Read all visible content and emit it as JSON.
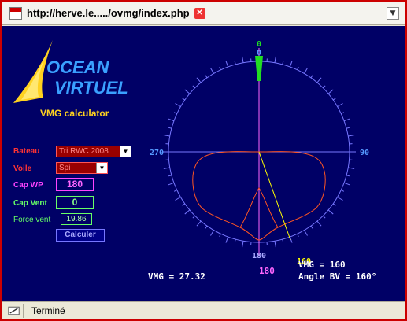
{
  "window": {
    "url": "http://herve.le...../ovmg/index.php"
  },
  "app": {
    "subtitle": "VMG calculator",
    "colors": {
      "background": "#000066",
      "accent": "#ffd21f",
      "polar": "#ff5522",
      "heading": "#ffff00",
      "compass": "#7777ff"
    }
  },
  "form": {
    "bateau": {
      "label": "Bateau",
      "value": "Tri RWC 2008"
    },
    "voile": {
      "label": "Voile",
      "value": "Spi"
    },
    "cap_wp": {
      "label": "Cap WP",
      "value": "180"
    },
    "cap_vent": {
      "label": "Cap Vent",
      "value": "0"
    },
    "force_vent": {
      "label": "Force vent",
      "value": "19.86"
    },
    "calculer_label": "Calculer"
  },
  "compass": {
    "top_label": "0",
    "top_label_inner": "0",
    "left_label": "270",
    "right_label": "90",
    "bottom_label": "180",
    "heading_label": "160"
  },
  "results": {
    "vmg_wp": "VMG = 27.32",
    "vmg_bottom_heading": "180",
    "vmg_best": "VMG = 160",
    "angle_bv": "Angle BV = 160°"
  },
  "status": {
    "text": "Terminé"
  }
}
